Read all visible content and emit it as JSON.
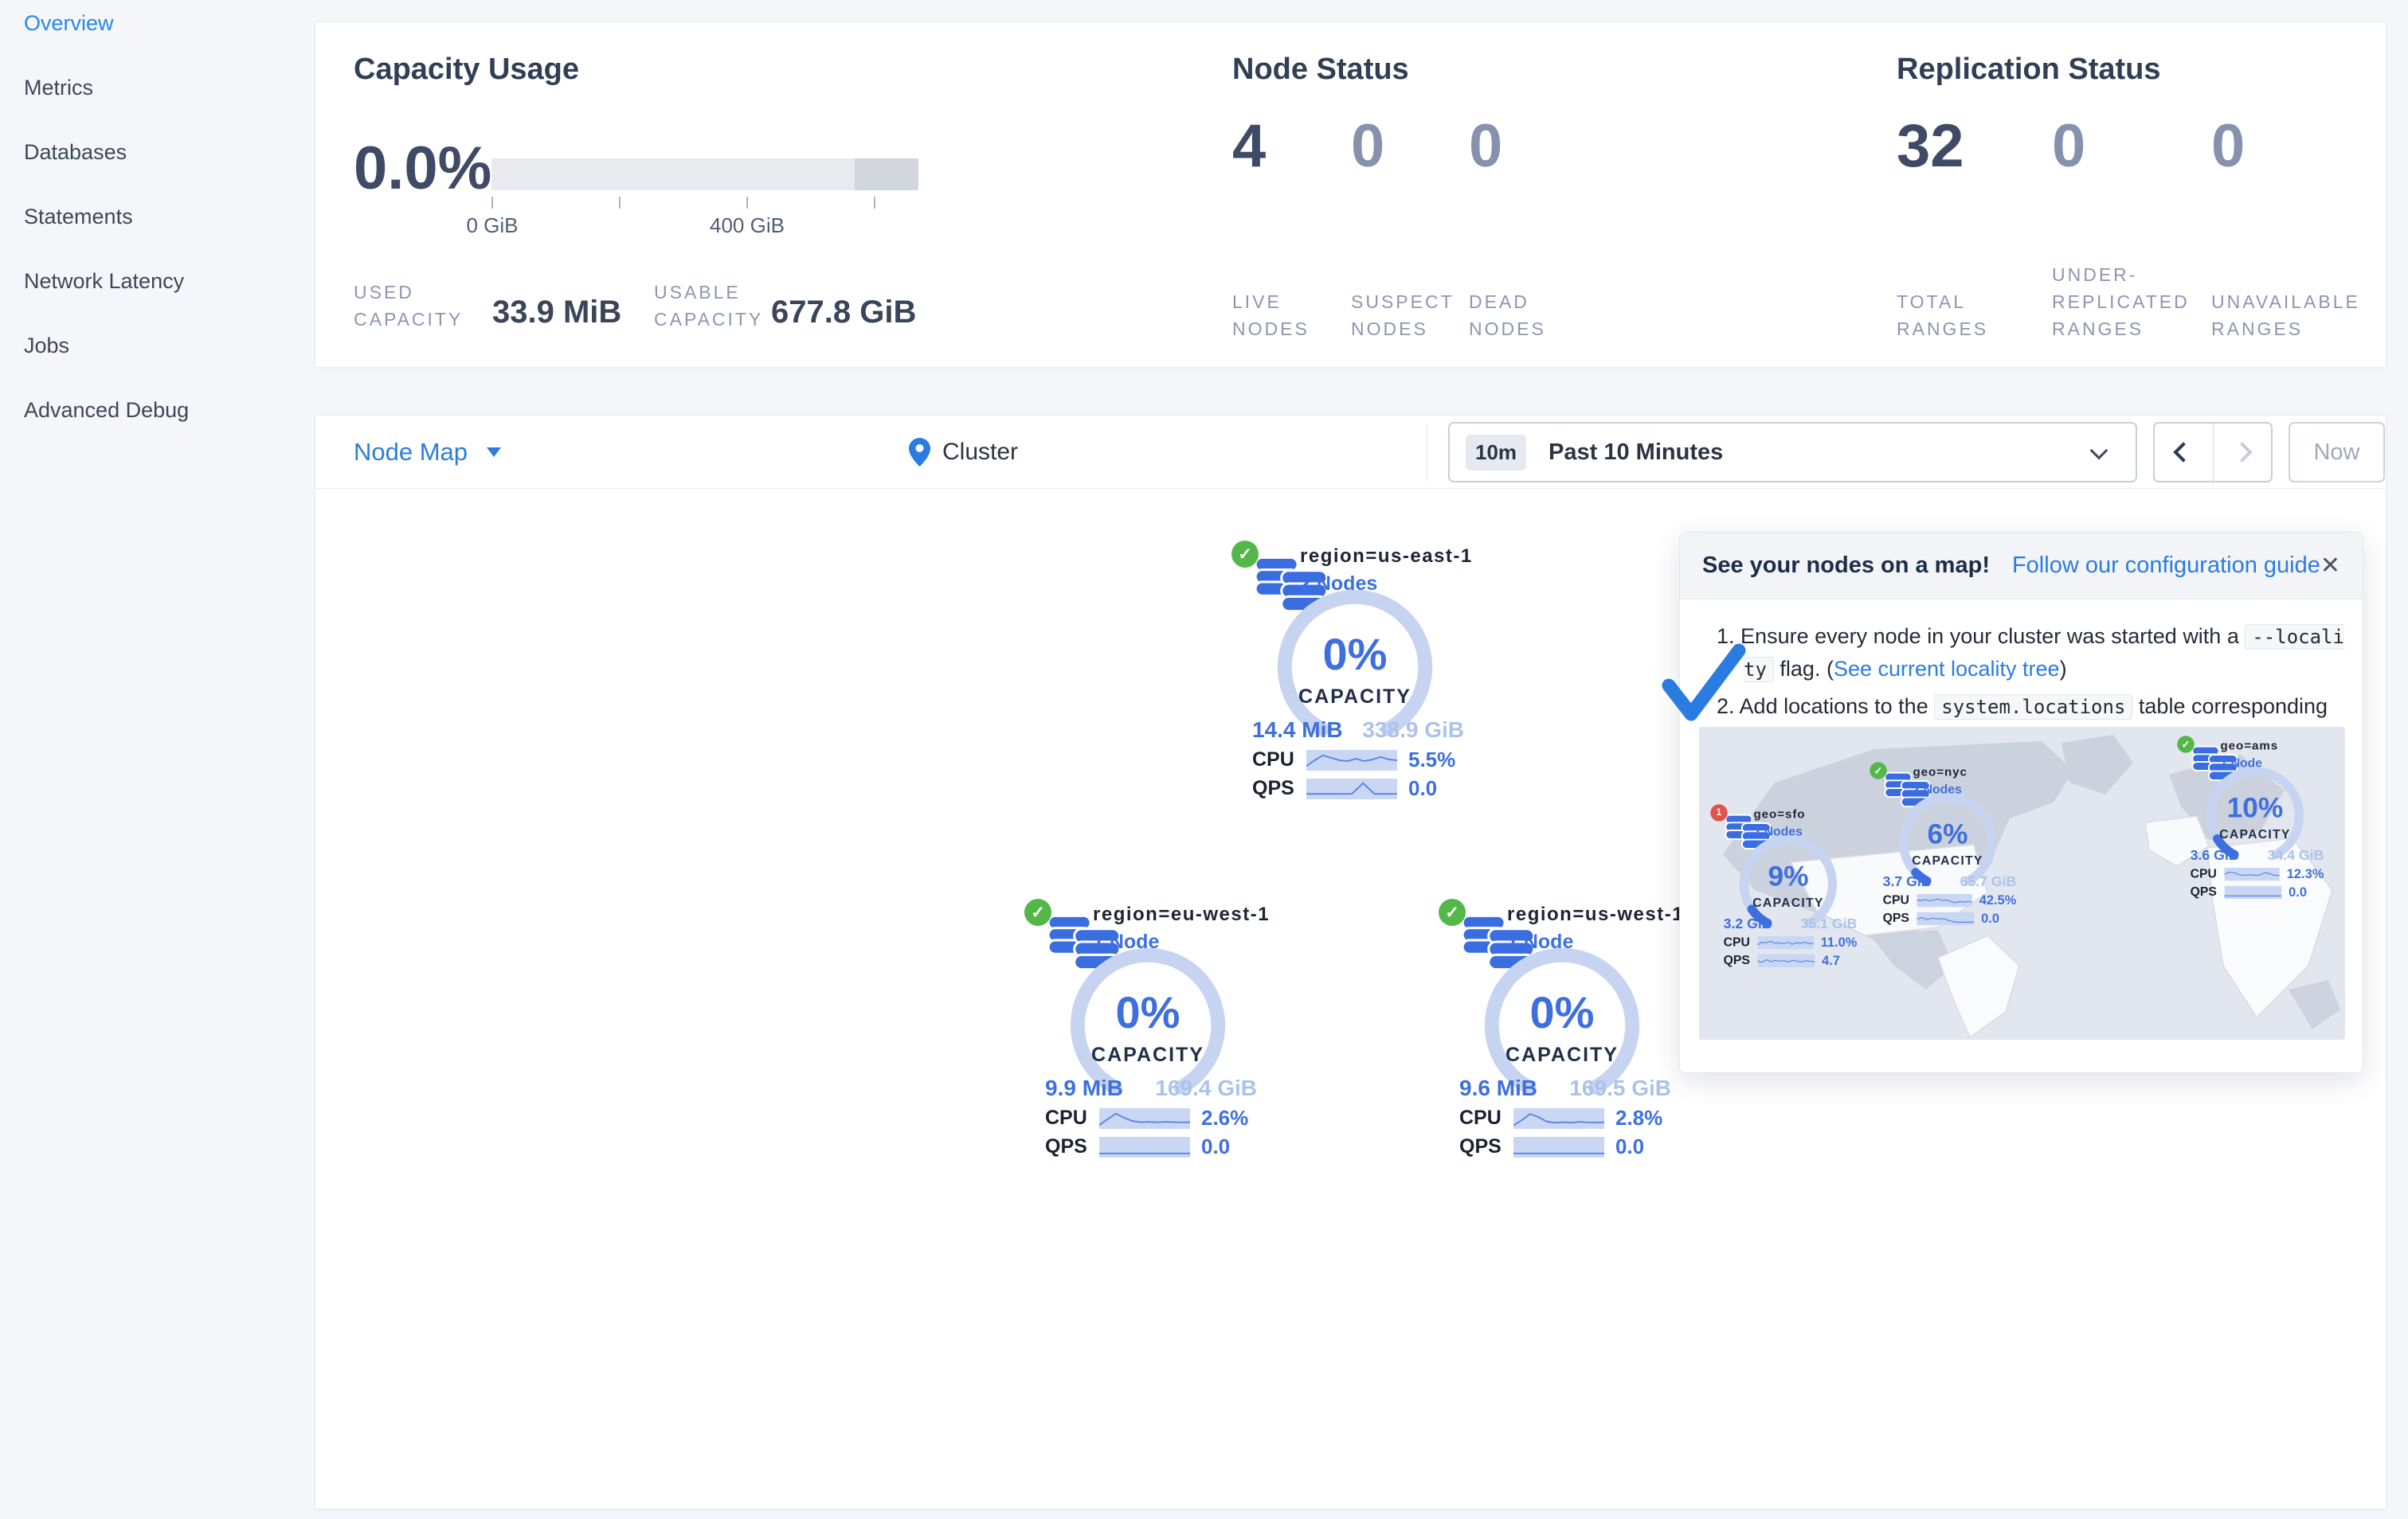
{
  "sidebar": {
    "items": [
      {
        "label": "Overview",
        "active": true
      },
      {
        "label": "Metrics",
        "active": false
      },
      {
        "label": "Databases",
        "active": false
      },
      {
        "label": "Statements",
        "active": false
      },
      {
        "label": "Network Latency",
        "active": false
      },
      {
        "label": "Jobs",
        "active": false
      },
      {
        "label": "Advanced Debug",
        "active": false
      }
    ]
  },
  "overview": {
    "capacity": {
      "title": "Capacity Usage",
      "percent": "0.0%",
      "tick_labels": [
        "0 GiB",
        "400 GiB"
      ],
      "stats": [
        {
          "label": "USED\nCAPACITY",
          "value": "33.9 MiB"
        },
        {
          "label": "USABLE\nCAPACITY",
          "value": "677.8 GiB"
        }
      ]
    },
    "nodes": {
      "title": "Node Status",
      "stats": [
        {
          "value": "4",
          "label": "LIVE\nNODES"
        },
        {
          "value": "0",
          "label": "SUSPECT\nNODES"
        },
        {
          "value": "0",
          "label": "DEAD\nNODES"
        }
      ]
    },
    "replication": {
      "title": "Replication Status",
      "stats": [
        {
          "value": "32",
          "label": "TOTAL\nRANGES"
        },
        {
          "value": "0",
          "label": "UNDER-\nREPLICATED\nRANGES"
        },
        {
          "value": "0",
          "label": "UNAVAILABLE\nRANGES"
        }
      ]
    }
  },
  "toolbar": {
    "view_label": "Node Map",
    "location_label": "Cluster",
    "time_badge": "10m",
    "time_label": "Past 10 Minutes",
    "now_label": "Now"
  },
  "regions": [
    {
      "name": "region=us-east-1",
      "nodes": "2 Nodes",
      "pct": 0,
      "pct_label": "0%",
      "capacity_label": "CAPACITY",
      "used": "14.4 MiB",
      "total": "338.9 GiB",
      "cpu_label": "CPU",
      "cpu_value": "5.5%",
      "qps_label": "QPS",
      "qps_value": "0.0",
      "cpu_spark": [
        0.85,
        0.5,
        0.2,
        0.35,
        0.5,
        0.55,
        0.4,
        0.55,
        0.45,
        0.3,
        0.45,
        0.5
      ],
      "qps_spark": [
        0.8,
        0.8,
        0.8,
        0.8,
        0.8,
        0.15,
        0.8,
        0.8,
        0.8
      ]
    },
    {
      "name": "region=eu-west-1",
      "nodes": "1 Node",
      "pct": 0,
      "pct_label": "0%",
      "capacity_label": "CAPACITY",
      "used": "9.9 MiB",
      "total": "169.4 GiB",
      "cpu_label": "CPU",
      "cpu_value": "2.6%",
      "qps_label": "QPS",
      "qps_value": "0.0",
      "cpu_spark": [
        0.9,
        0.55,
        0.2,
        0.45,
        0.65,
        0.72,
        0.7,
        0.73,
        0.7,
        0.72,
        0.73,
        0.72
      ],
      "qps_spark": [
        0.88,
        0.88,
        0.88,
        0.88,
        0.88,
        0.88,
        0.88,
        0.88,
        0.88,
        0.88,
        0.88,
        0.88
      ]
    },
    {
      "name": "region=us-west-1",
      "nodes": "1 Node",
      "pct": 0,
      "pct_label": "0%",
      "capacity_label": "CAPACITY",
      "used": "9.6 MiB",
      "total": "169.5 GiB",
      "cpu_label": "CPU",
      "cpu_value": "2.8%",
      "qps_label": "QPS",
      "qps_value": "0.0",
      "cpu_spark": [
        0.92,
        0.6,
        0.22,
        0.4,
        0.68,
        0.75,
        0.72,
        0.75,
        0.7,
        0.73,
        0.74,
        0.73
      ],
      "qps_spark": [
        0.88,
        0.88,
        0.88,
        0.88,
        0.88,
        0.88,
        0.88,
        0.88,
        0.88,
        0.88,
        0.88,
        0.88
      ]
    }
  ],
  "popup": {
    "title": "See your nodes on a map!",
    "link": "Follow our configuration guide",
    "close": "✕",
    "steps": [
      {
        "num": "1.",
        "pre": "Ensure every node in your cluster was started with a ",
        "code": "--locality",
        "mid": " flag. (",
        "link": "See current locality tree",
        "post": ")"
      },
      {
        "num": "2.",
        "pre": "Add locations to the ",
        "code": "system.locations",
        "post": " table corresponding to your locality flags."
      }
    ],
    "regions": [
      {
        "badge": "1",
        "name": "geo=sfo",
        "nodes": "2 Nodes",
        "pct": 9,
        "pct_label": "9%",
        "capacity_label": "CAPACITY",
        "used": "3.2 GiB",
        "total": "35.1 GiB",
        "cpu_label": "CPU",
        "cpu_value": "11.0%",
        "qps_label": "QPS",
        "qps_value": "4.7",
        "cpu_spark": [
          0.7,
          0.45,
          0.5,
          0.35,
          0.55,
          0.5,
          0.6,
          0.45,
          0.65,
          0.5,
          0.55,
          0.45,
          0.6,
          0.55
        ],
        "qps_spark": [
          0.5,
          0.65,
          0.4,
          0.6,
          0.45,
          0.55,
          0.5,
          0.6,
          0.45,
          0.55,
          0.6,
          0.5,
          0.55,
          0.6
        ]
      },
      {
        "badge": "✓",
        "name": "geo=nyc",
        "nodes": "2 Nodes",
        "pct": 6,
        "pct_label": "6%",
        "capacity_label": "CAPACITY",
        "used": "3.7 GiB",
        "total": "65.7 GiB",
        "cpu_label": "CPU",
        "cpu_value": "42.5%",
        "qps_label": "QPS",
        "qps_value": "0.0",
        "cpu_spark": [
          0.45,
          0.5,
          0.4,
          0.55,
          0.45,
          0.35,
          0.5,
          0.45,
          0.6,
          0.7,
          0.6,
          0.65,
          0.6,
          0.65
        ],
        "qps_spark": [
          0.55,
          0.4,
          0.6,
          0.45,
          0.55,
          0.5,
          0.65,
          0.8,
          0.85,
          0.85,
          0.85,
          0.85
        ]
      },
      {
        "badge": "✓",
        "name": "geo=ams",
        "nodes": "1 Node",
        "pct": 10,
        "pct_label": "10%",
        "capacity_label": "CAPACITY",
        "used": "3.6 GiB",
        "total": "34.4 GiB",
        "cpu_label": "CPU",
        "cpu_value": "12.3%",
        "qps_label": "QPS",
        "qps_value": "0.0",
        "cpu_spark": [
          0.5,
          0.3,
          0.35,
          0.55,
          0.6,
          0.55,
          0.6,
          0.58,
          0.35,
          0.45,
          0.6,
          0.62
        ],
        "qps_spark": [
          0.85,
          0.85,
          0.85,
          0.85,
          0.85,
          0.85,
          0.85,
          0.85,
          0.85,
          0.85,
          0.85,
          0.85
        ]
      }
    ]
  }
}
